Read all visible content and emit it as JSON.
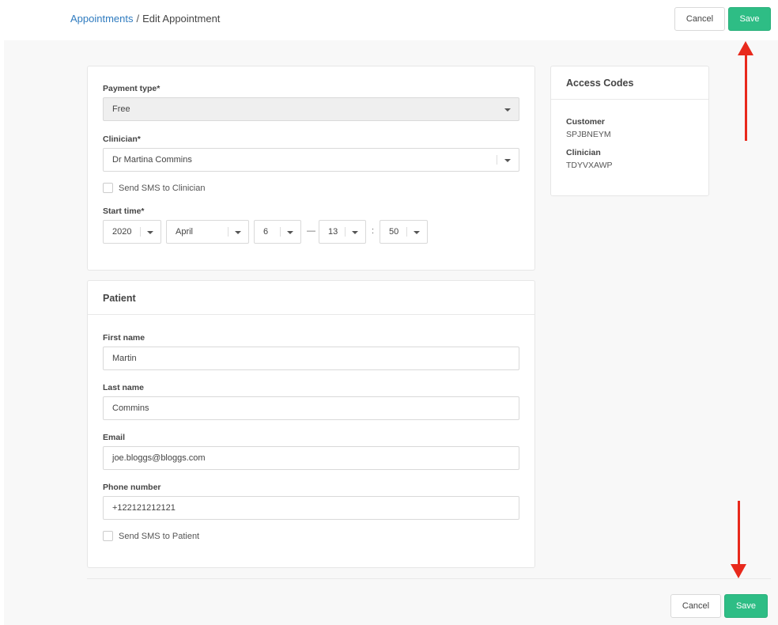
{
  "breadcrumb": {
    "parent": "Appointments",
    "separator": "/",
    "current": "Edit Appointment"
  },
  "header_actions": {
    "cancel": "Cancel",
    "save": "Save"
  },
  "appointment": {
    "payment_type": {
      "label": "Payment type*",
      "value": "Free"
    },
    "clinician": {
      "label": "Clinician*",
      "value": "Dr Martina Commins"
    },
    "send_sms_clinician": {
      "label": "Send SMS to Clinician",
      "checked": false
    },
    "start_time": {
      "label": "Start time*",
      "year": "2020",
      "month": "April",
      "day": "6",
      "dash": "—",
      "hour": "13",
      "colon": ":",
      "minute": "50"
    }
  },
  "patient": {
    "title": "Patient",
    "first_name": {
      "label": "First name",
      "value": "Martin"
    },
    "last_name": {
      "label": "Last name",
      "value": "Commins"
    },
    "email": {
      "label": "Email",
      "value": "joe.bloggs@bloggs.com"
    },
    "phone": {
      "label": "Phone number",
      "value": "+122121212121"
    },
    "send_sms_patient": {
      "label": "Send SMS to Patient",
      "checked": false
    }
  },
  "access_codes": {
    "title": "Access Codes",
    "customer": {
      "label": "Customer",
      "value": "SPJBNEYM"
    },
    "clinician": {
      "label": "Clinician",
      "value": "TDYVXAWP"
    }
  },
  "footer_actions": {
    "cancel": "Cancel",
    "save": "Save"
  },
  "colors": {
    "primary": "#2ebd85",
    "link": "#2f7bbf",
    "annotation_arrow": "#e8291c"
  }
}
